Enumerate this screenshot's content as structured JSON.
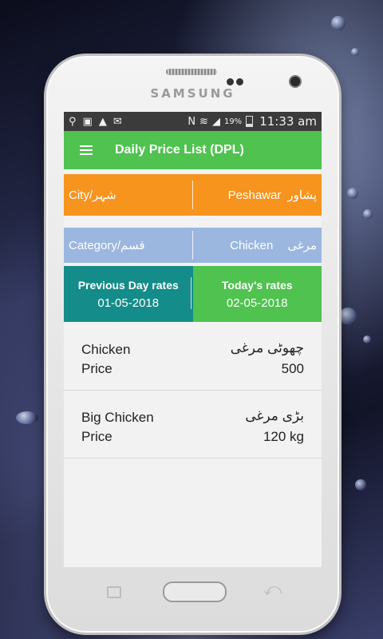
{
  "device": {
    "brand": "SAMSUNG"
  },
  "status_bar": {
    "battery": "19%",
    "time": "11:33 am",
    "left_icons": [
      "location-icon",
      "image-icon",
      "warning-icon",
      "mail-icon"
    ],
    "right_icons": [
      "nfc-icon",
      "wifi-icon",
      "signal-icon",
      "battery-icon"
    ]
  },
  "toolbar": {
    "title": "Daily Price List (DPL)",
    "menu_icon": "hamburger-menu-icon"
  },
  "city": {
    "label": "City/شہر",
    "value": "Peshawar",
    "value_urdu": "پشاور"
  },
  "category": {
    "label": "Category/قسم",
    "value": "Chicken",
    "value_urdu": "مرغی"
  },
  "rates": {
    "previous": {
      "label": "Previous Day rates",
      "date": "01-05-2018"
    },
    "today": {
      "label": "Today's rates",
      "date": "02-05-2018"
    }
  },
  "items": [
    {
      "name": "Chicken",
      "name_urdu": "چھوٹی مرغی",
      "price_label": "Price",
      "price": "500"
    },
    {
      "name": "Big Chicken",
      "name_urdu": "بڑی مرغی",
      "price_label": "Price",
      "price": "120 kg"
    }
  ],
  "colors": {
    "toolbar": "#4fc24f",
    "city_row": "#f7941d",
    "category_row": "#9bb7e0",
    "previous_rates": "#148c89",
    "today_rates": "#4fc24f"
  }
}
